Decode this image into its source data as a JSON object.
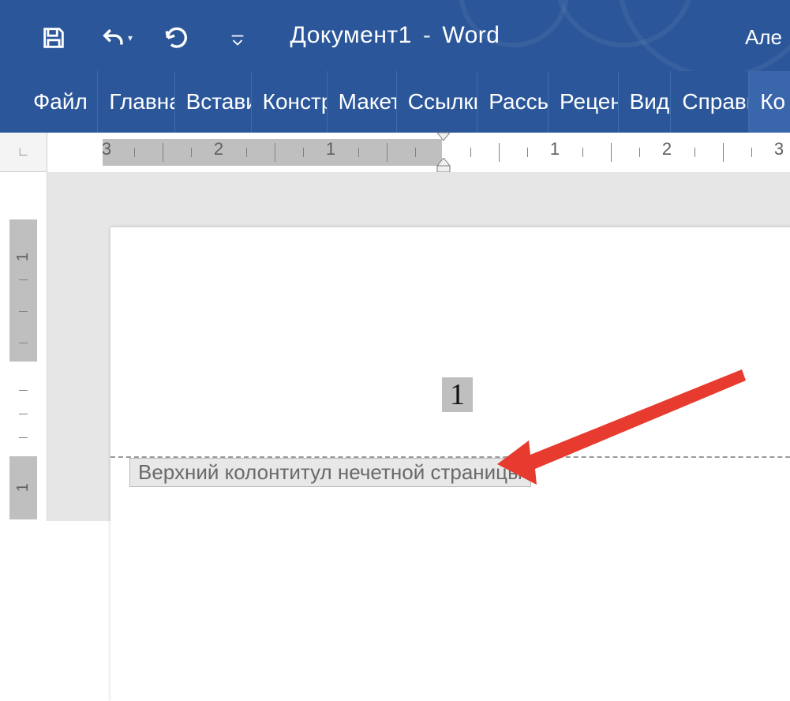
{
  "title": {
    "document_name": "Документ1",
    "separator": "-",
    "app_name": "Word",
    "account_name_fragment": "Але"
  },
  "qat": {
    "save_tooltip": "Save",
    "undo_tooltip": "Undo",
    "redo_tooltip": "Redo",
    "customize_tooltip": "Customize Quick Access Toolbar"
  },
  "ribbon": {
    "tabs": [
      "Файл",
      "Главна",
      "Встави",
      "Констр",
      "Макет",
      "Ссылки",
      "Рассы",
      "Рецен",
      "Вид",
      "Справк",
      "Ко"
    ]
  },
  "ruler": {
    "corner_label": "∟",
    "h_numbers_left": [
      "3",
      "2",
      "1"
    ],
    "h_numbers_right": [
      "1",
      "2",
      "3"
    ]
  },
  "document": {
    "page_number": "1",
    "header_label": "Верхний колонтитул нечетной страницы"
  },
  "annotation": {
    "arrow_color": "#e63b2e"
  }
}
